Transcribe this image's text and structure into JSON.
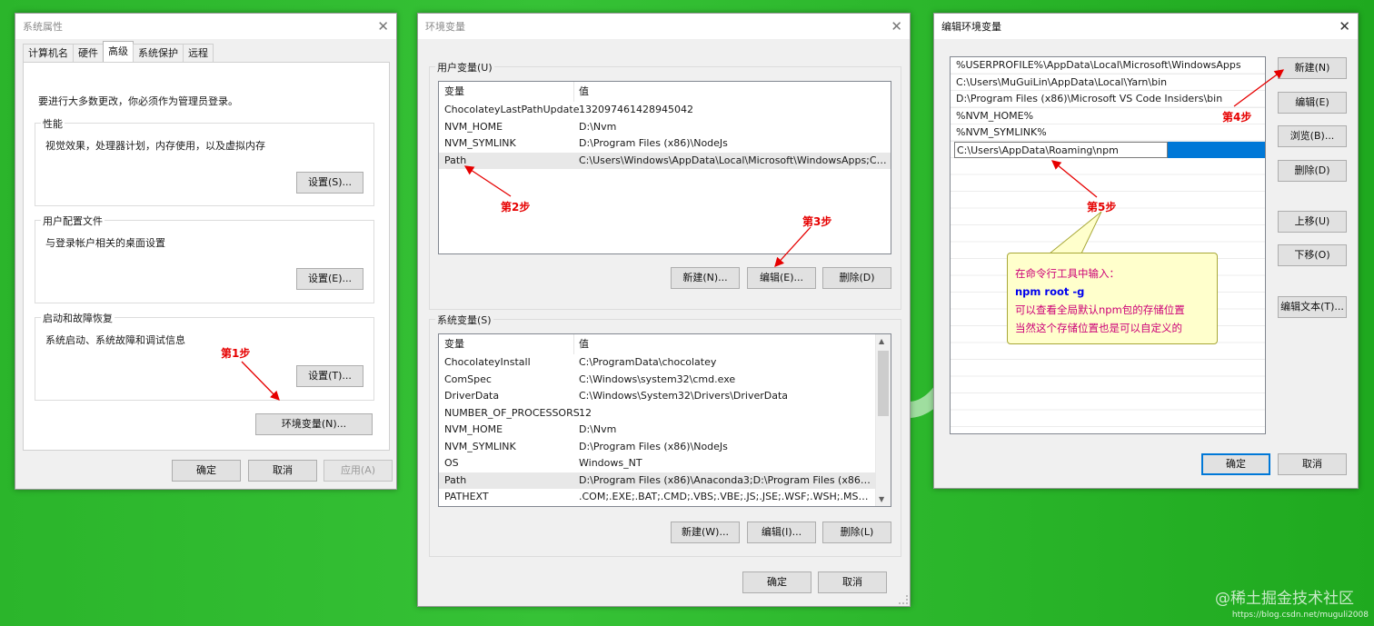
{
  "sysprops": {
    "title": "系统属性",
    "tabs": [
      "计算机名",
      "硬件",
      "高级",
      "系统保护",
      "远程"
    ],
    "admin_note": "要进行大多数更改，你必须作为管理员登录。",
    "perf": {
      "label": "性能",
      "desc": "视觉效果，处理器计划，内存使用，以及虚拟内存",
      "btn": "设置(S)..."
    },
    "profile": {
      "label": "用户配置文件",
      "desc": "与登录帐户相关的桌面设置",
      "btn": "设置(E)..."
    },
    "startup": {
      "label": "启动和故障恢复",
      "desc": "系统启动、系统故障和调试信息",
      "btn": "设置(T)..."
    },
    "envvars_btn": "环境变量(N)...",
    "ok": "确定",
    "cancel": "取消",
    "apply": "应用(A)"
  },
  "envvars": {
    "title": "环境变量",
    "user_section": "用户变量(U)",
    "columns": [
      "变量",
      "值"
    ],
    "user_rows": [
      [
        "ChocolateyLastPathUpdate",
        "132097461428945042"
      ],
      [
        "NVM_HOME",
        "D:\\Nvm"
      ],
      [
        "NVM_SYMLINK",
        "D:\\Program Files (x86)\\NodeJs"
      ],
      [
        "Path",
        "C:\\Users\\Windows\\AppData\\Local\\Microsoft\\WindowsApps;C:\\..."
      ]
    ],
    "user_new": "新建(N)...",
    "user_edit": "编辑(E)...",
    "user_delete": "删除(D)",
    "sys_section": "系统变量(S)",
    "sys_rows": [
      [
        "ChocolateyInstall",
        "C:\\ProgramData\\chocolatey"
      ],
      [
        "ComSpec",
        "C:\\Windows\\system32\\cmd.exe"
      ],
      [
        "DriverData",
        "C:\\Windows\\System32\\Drivers\\DriverData"
      ],
      [
        "NUMBER_OF_PROCESSORS",
        "12"
      ],
      [
        "NVM_HOME",
        "D:\\Nvm"
      ],
      [
        "NVM_SYMLINK",
        "D:\\Program Files (x86)\\NodeJs"
      ],
      [
        "OS",
        "Windows_NT"
      ],
      [
        "Path",
        "D:\\Program Files (x86)\\Anaconda3;D:\\Program Files (x86)\\An..."
      ],
      [
        "PATHEXT",
        ".COM;.EXE;.BAT;.CMD;.VBS;.VBE;.JS;.JSE;.WSF;.WSH;.MSC;.PY;.P..."
      ]
    ],
    "sys_new": "新建(W)...",
    "sys_edit": "编辑(I)...",
    "sys_delete": "删除(L)",
    "ok": "确定",
    "cancel": "取消"
  },
  "editenv": {
    "title": "编辑环境变量",
    "paths": [
      "%USERPROFILE%\\AppData\\Local\\Microsoft\\WindowsApps",
      "C:\\Users\\MuGuiLin\\AppData\\Local\\Yarn\\bin",
      "D:\\Program Files (x86)\\Microsoft VS Code Insiders\\bin",
      "%NVM_HOME%",
      "%NVM_SYMLINK%"
    ],
    "editing_value": "C:\\Users\\AppData\\Roaming\\npm",
    "buttons": {
      "new": "新建(N)",
      "edit": "编辑(E)",
      "browse": "浏览(B)...",
      "delete": "删除(D)",
      "up": "上移(U)",
      "down": "下移(O)",
      "edit_text": "编辑文本(T)..."
    },
    "ok": "确定",
    "cancel": "取消"
  },
  "annotations": {
    "step1": "第1步",
    "step2": "第2步",
    "step3": "第3步",
    "step4": "第4步",
    "step5": "第5步"
  },
  "note": {
    "line1": "在命令行工具中输入：",
    "line2": "npm root -g",
    "line3": "可以查看全局默认npm包的存储位置",
    "line4": "当然这个存储位置也是可以自定义的"
  },
  "watermark": "@稀土掘金技术社区",
  "watermark_url": "https://blog.csdn.net/muguli2008"
}
